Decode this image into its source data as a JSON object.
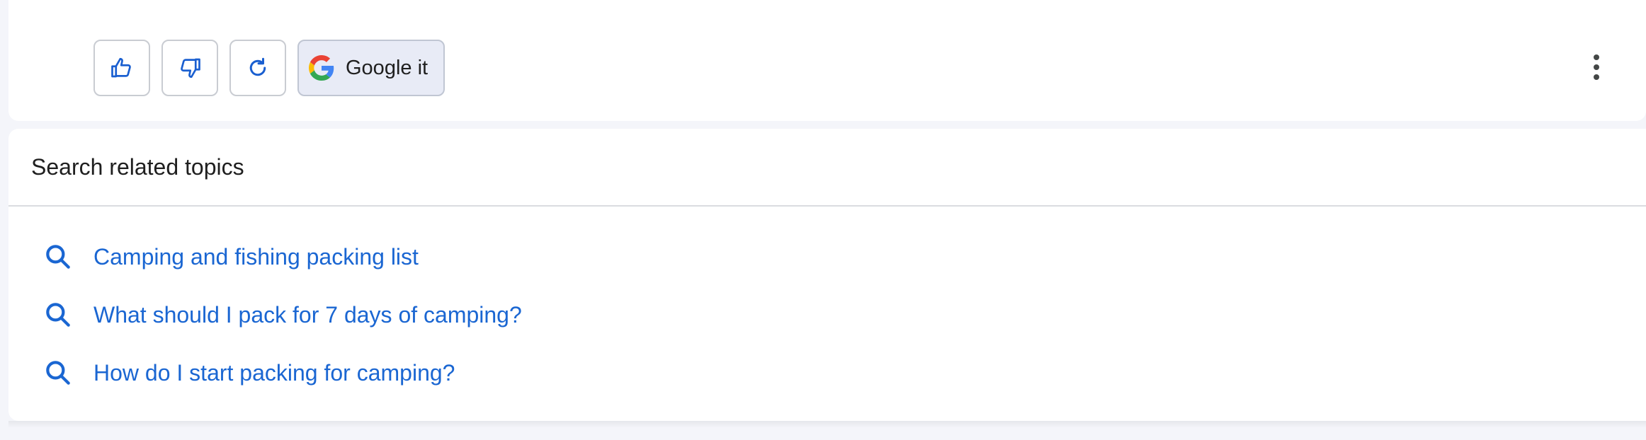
{
  "actions": {
    "thumbs_up_icon": "thumbs-up-icon",
    "thumbs_down_icon": "thumbs-down-icon",
    "regenerate_icon": "refresh-icon",
    "google_it_label": "Google it",
    "google_icon": "google-g-icon",
    "more_icon": "more-vert-icon"
  },
  "related": {
    "title": "Search related topics",
    "items": [
      {
        "label": "Camping and fishing packing list",
        "icon": "search-icon"
      },
      {
        "label": "What should I pack for 7 days of camping?",
        "icon": "search-icon"
      },
      {
        "label": "How do I start packing for camping?",
        "icon": "search-icon"
      }
    ]
  },
  "colors": {
    "link": "#1a66d2",
    "icon_blue": "#1a5fd0",
    "background": "#f4f5fa",
    "google_button_bg": "#e8ebf6"
  }
}
